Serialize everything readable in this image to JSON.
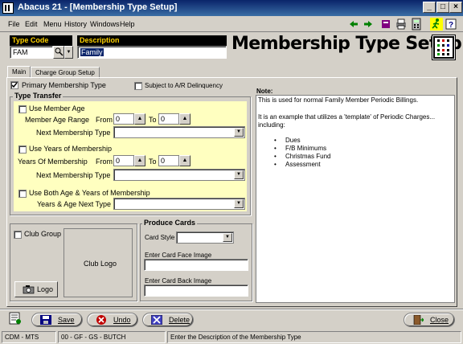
{
  "window": {
    "title": "Abacus 21 - [Membership Type Setup]"
  },
  "menu": [
    "File",
    "Edit",
    "Menu",
    "History",
    "Windows",
    "Help"
  ],
  "header": {
    "type_code_label": "Type Code",
    "type_code_value": "FAM",
    "description_label": "Description",
    "description_value": "Family",
    "page_title": "Membership Type Setup"
  },
  "tabs": [
    "Main",
    "Charge Group Setup"
  ],
  "main": {
    "primary_label": "Primary Membership Type",
    "primary_checked": true,
    "ar_label": "Subject to A/R Delinquency",
    "type_transfer_title": "Type Transfer",
    "use_member_age": "Use Member Age",
    "member_age_range": "Member Age Range",
    "from_label": "From",
    "to_label": "To",
    "from1": "0",
    "to1": "0",
    "next_type_label": "Next Membership Type",
    "use_years": "Use Years of Membership",
    "years_of_membership": "Years Of Membership",
    "from2": "0",
    "to2": "0",
    "use_both": "Use Both Age & Years of Membership",
    "years_age_next": "Years & Age Next Type",
    "club_group_label": "Club Group",
    "club_logo_label": "Club Logo",
    "logo_button": "Logo",
    "produce_cards_title": "Produce Cards",
    "card_style_label": "Card Style",
    "card_face_label": "Enter Card Face Image",
    "card_back_label": "Enter Card Back Image"
  },
  "note": {
    "label": "Note:",
    "line1": "This is used for normal Family Member Periodic Billings.",
    "line2": "It is an example that utilizes a 'template' of Periodic Charges... including:",
    "items": [
      "Dues",
      "F/B Minimums",
      "Christmas Fund",
      "Assessment"
    ]
  },
  "buttons": {
    "save": "Save",
    "undo": "Undo",
    "delete": "Delete",
    "close": "Close"
  },
  "status": {
    "left": "CDM - MTS",
    "middle": "00 - GF - GS - BUTCH",
    "message": "Enter the Description of the Membership Type"
  },
  "colors": {
    "title_bar": "#0a246a",
    "field_header_text": "#ffd200",
    "yellow_panel": "#ffffc0",
    "window_bg": "#d4d0c8"
  },
  "icons": [
    "app-logo-icon",
    "back-arrow-icon",
    "forward-arrow-icon",
    "book-icon",
    "print-icon",
    "calculator-icon",
    "running-man-icon",
    "help-icon",
    "search-icon",
    "chevron-down-icon",
    "checkmark-icon",
    "save-icon",
    "undo-icon",
    "delete-icon",
    "close-icon",
    "camera-icon"
  ]
}
